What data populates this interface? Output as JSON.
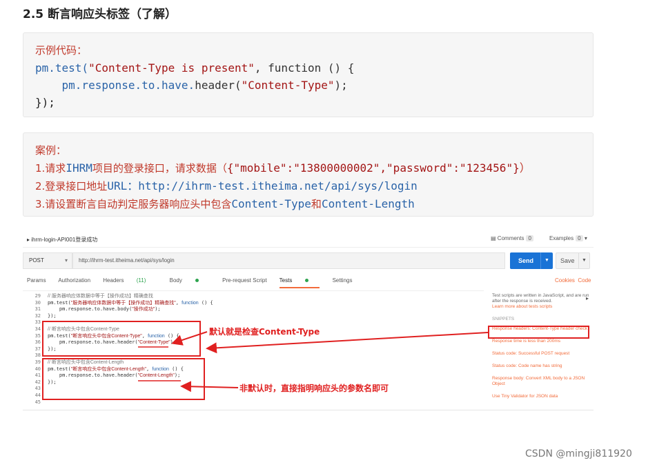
{
  "heading": "2.5 断言响应头标签（了解）",
  "example": {
    "label": "示例代码：",
    "line1_obj": "pm.test(",
    "line1_str": "\"Content-Type is present\"",
    "line1_rest": ", function () {",
    "line2_indent": "    ",
    "line2_obj": "pm.response.to.have.",
    "line2_fn": "header(",
    "line2_str": "\"Content-Type\"",
    "line2_end": ");",
    "line3": "});"
  },
  "case": {
    "label": "案例：",
    "line1_prefix": "1.请求",
    "line1_code": "IHRM",
    "line1_mid": "项目的登录接口，请求数据（",
    "line1_json": "{\"mobile\":\"13800000002\",\"password\":\"123456\"}",
    "line1_end": "）",
    "line2_prefix": "2.登录接口地址",
    "line2_url_label": "URL：",
    "line2_url": "http://ihrm-test.itheima.net/api/sys/login",
    "line3_prefix": "3.请设置断言自动判定服务器响应头中包含",
    "line3_a": "Content-Type",
    "line3_and": "和",
    "line3_b": "Content-Length"
  },
  "postman": {
    "breadcrumb": "ihrm-login-API001登录成功",
    "comments_label": "Comments",
    "comments_count": "0",
    "examples_label": "Examples",
    "examples_count": "0",
    "method": "POST",
    "url": "http://ihrm-test.itheima.net/api/sys/login",
    "send": "Send",
    "save": "Save",
    "tabs": [
      "Params",
      "Authorization",
      "Headers",
      "Body",
      "Pre-request Script",
      "Tests",
      "Settings"
    ],
    "headers_count": "(11)",
    "cookies": "Cookies",
    "code_link": "Code",
    "line_numbers": "29\n30\n31\n32\n33\n34\n35\n36\n37\n38\n39\n40\n41\n42\n43\n44\n45",
    "side_intro": "Test scripts are written in JavaScript, and are run after the response is received.",
    "side_learn": "Learn more about tests scripts",
    "snippets_label": "SNIPPETS",
    "snippets": [
      "Response headers: Content-Type header check",
      "Response time is less than 200ms",
      "Status code: Successful POST request",
      "Status code: Code name has string",
      "Response body: Convert XML body to a JSON Object",
      "Use Tiny Validator for JSON data"
    ]
  },
  "annotations": {
    "default_note": "默认就是检查Content-Type",
    "nondefault_note": "非默认时，直接指明响应头的参数名即可"
  },
  "watermark": "CSDN @mingji811920"
}
